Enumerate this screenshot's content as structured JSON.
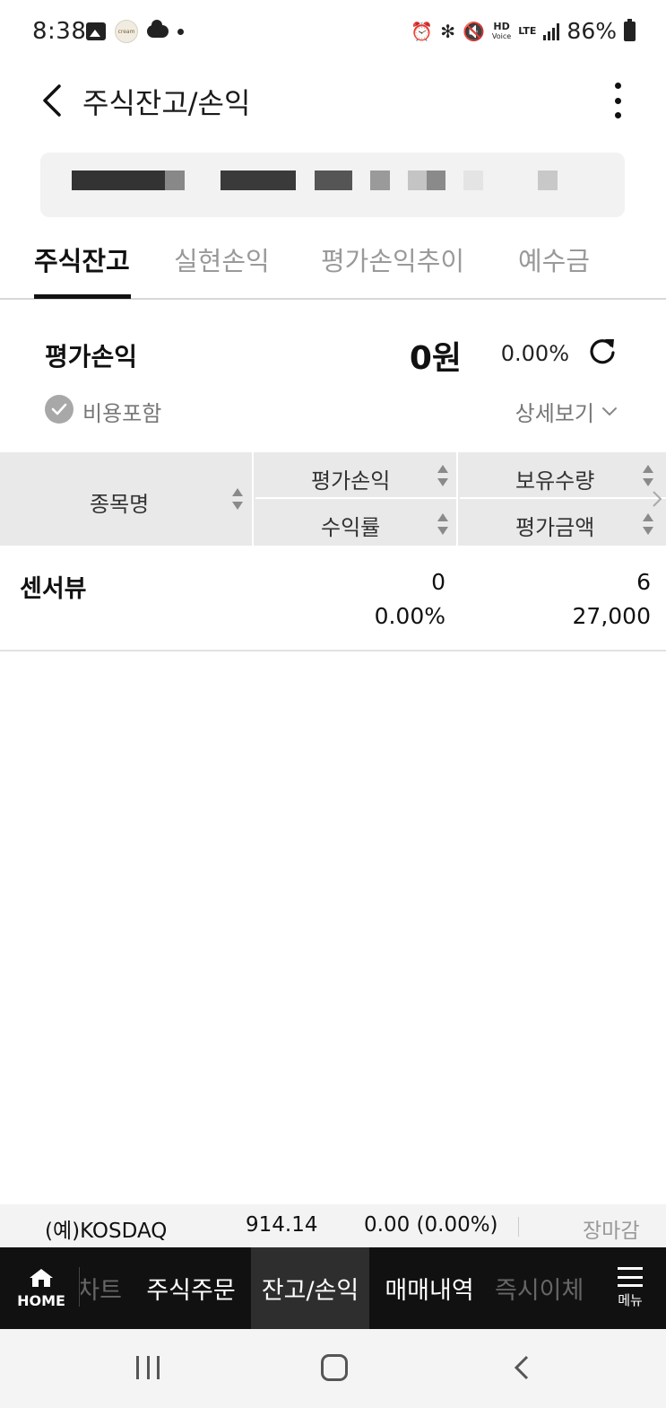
{
  "status_bar": {
    "time": "8:38",
    "app_badge": "cream",
    "network": "HD",
    "network_sub": "Voice",
    "lte": "LTE",
    "battery": "86%"
  },
  "header": {
    "title": "주식잔고/손익"
  },
  "tabs": [
    {
      "label": "주식잔고",
      "active": true
    },
    {
      "label": "실현손익",
      "active": false
    },
    {
      "label": "평가손익추이",
      "active": false
    },
    {
      "label": "예수금",
      "active": false
    }
  ],
  "summary": {
    "label": "평가손익",
    "amount": "0원",
    "rate": "0.00%",
    "cost_included": "비용포함",
    "detail_link": "상세보기"
  },
  "table": {
    "headers": {
      "name": "종목명",
      "eval_profit": "평가손익",
      "quantity": "보유수량",
      "return_rate": "수익률",
      "eval_amount": "평가금액"
    },
    "rows": [
      {
        "name": "센서뷰",
        "eval_profit": "0",
        "return_rate": "0.00%",
        "quantity": "6",
        "eval_amount": "27,000"
      }
    ]
  },
  "ticker": {
    "index_name": "(예)KOSDAQ",
    "value": "914.14",
    "change": "0.00 (0.00%)",
    "status": "장마감"
  },
  "bottom_nav": {
    "home": "HOME",
    "items": [
      "차트",
      "주식주문",
      "잔고/손익",
      "매매내역",
      "즉시이체"
    ],
    "active": "잔고/손익",
    "menu": "메뉴"
  },
  "colors": {
    "active_tab": "#111111",
    "inactive_tab": "#999999",
    "table_header_bg": "#e9e9e9",
    "nav_bg": "#111111",
    "nav_active_bg": "#2e2e2e"
  }
}
